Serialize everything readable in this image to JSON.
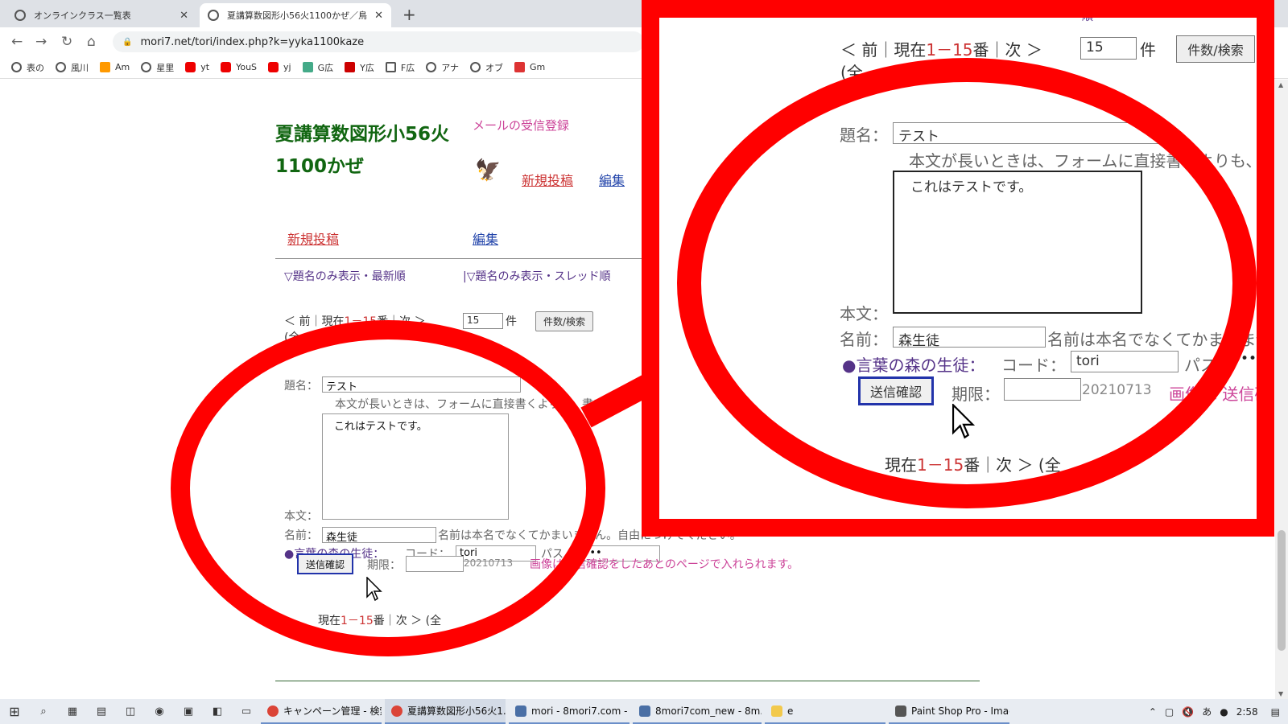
{
  "browser": {
    "tabs": [
      {
        "title": "オンラインクラス一覧表",
        "active": false
      },
      {
        "title": "夏講算数図形小56火1100かぜ／鳥",
        "active": true
      }
    ],
    "url": "mori7.net/tori/index.php?k=yyka1100kaze",
    "bookmarks": [
      "表の",
      "風川",
      "Am",
      "星里",
      "yt",
      "YouS",
      "yj",
      "G広",
      "Y広",
      "F広",
      "アナ",
      "オブ",
      "Gm"
    ]
  },
  "page": {
    "title": "夏講算数図形小56火1100かぜ",
    "mail_link": "メールの受信登録",
    "new_post": "新規投稿",
    "edit": "編集",
    "view_latest": "▽題名のみ表示・最新順",
    "view_thread": "|▽題名のみ表示・スレッド順",
    "pager_prev": "＜ 前｜現在",
    "pager_range": "1－15",
    "pager_next": "番｜次 ＞",
    "pager_total": "(全",
    "count_value": "15",
    "count_unit": "件",
    "search_button": "件数/検索",
    "subject_label": "題名：",
    "subject_value": "テスト",
    "body_hint": "本文が長いときは、フォームに直接書くよりも、書い",
    "body_label": "本文：",
    "body_value": "これはテストです。",
    "name_label": "名前：",
    "name_value": "森生徒",
    "name_hint": "名前は本名でなくてかまいません。自由につけてください。",
    "member_label": "●言葉の森の生徒：",
    "code_label": "コード：",
    "code_value": "tori",
    "pass_label": "パス",
    "pass_value": "••••",
    "confirm_button": "送信確認",
    "deadline_label": "期限：",
    "deadline_value": "20210713",
    "image_hint": "画像は送信確認をしたあとのページで入れられます。",
    "zoom_pager_prefix": "現在",
    "zoom_pager_range": "1－15",
    "zoom_pager_suffix": "番｜次 ＞ (全",
    "zoom_top_fragment": "順",
    "zoom_body_hint": "本文が長いときは、フォームに直接書くよりも、",
    "zoom_name_hint": "名前は本名でなくてかまいません",
    "zoom_image_hint": "画像は 送信確"
  },
  "taskbar": {
    "items": [
      "キャンペーン管理 - 検索...",
      "夏講算数図形小56火1...",
      "mori - 8mori7.com - ...",
      "8mori7com_new - 8m...",
      "e",
      "Paint Shop Pro - Imag..."
    ],
    "time": "2:58",
    "ime": "あ"
  },
  "colors": {
    "annotation": "#ff0000",
    "title_green": "#116611",
    "link_red": "#cc3333",
    "link_pink": "#cc4499"
  }
}
